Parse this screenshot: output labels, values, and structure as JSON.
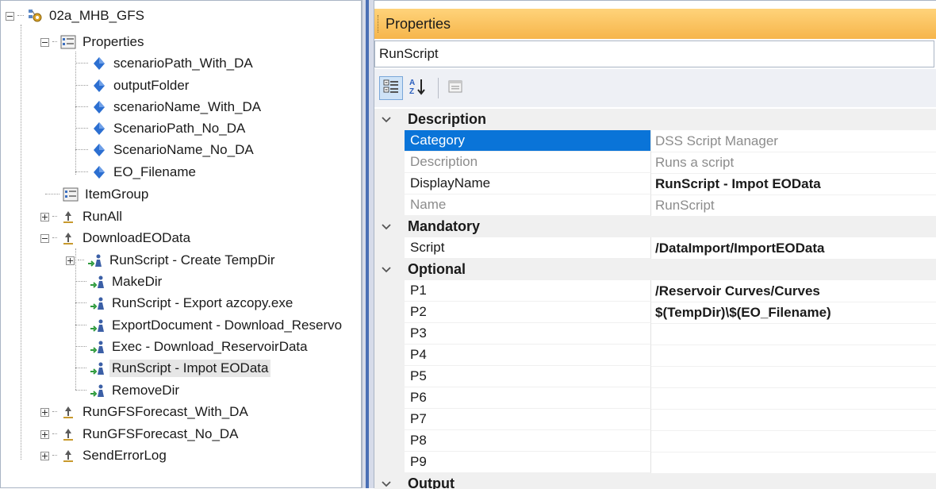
{
  "tree": {
    "root": {
      "label": "02a_MHB_GFS",
      "icon": "gear-network-icon"
    },
    "properties_node": {
      "label": "Properties",
      "icon": "property-grid-icon"
    },
    "property_items": [
      "scenarioPath_With_DA",
      "outputFolder",
      "scenarioName_With_DA",
      "ScenarioPath_No_DA",
      "ScenarioName_No_DA",
      "EO_Filename"
    ],
    "item_group": {
      "label": "ItemGroup",
      "icon": "property-grid-icon"
    },
    "run_all": {
      "label": "RunAll",
      "icon": "task-icon"
    },
    "download_eo": {
      "label": "DownloadEOData",
      "icon": "task-icon"
    },
    "download_children": [
      {
        "label": "RunScript - Create TempDir",
        "expandable": true
      },
      {
        "label": "MakeDir",
        "expandable": false
      },
      {
        "label": "RunScript - Export azcopy.exe",
        "expandable": false
      },
      {
        "label": "ExportDocument - Download_Reservo",
        "expandable": false
      },
      {
        "label": "Exec - Download_ReservoirData",
        "expandable": false
      },
      {
        "label": "RunScript - Impot EOData",
        "expandable": false,
        "selected": true
      },
      {
        "label": "RemoveDir",
        "expandable": false
      }
    ],
    "bottom_items": [
      "RunGFSForecast_With_DA",
      "RunGFSForecast_No_DA",
      "SendErrorLog"
    ]
  },
  "properties": {
    "title": "Properties",
    "object_name": "RunScript",
    "toolbar": [
      "categorized-icon",
      "alphabetical-sort-icon",
      "property-pages-icon"
    ],
    "categories": [
      {
        "name": "Description",
        "rows": [
          {
            "name": "Category",
            "value": "DSS Script Manager",
            "readonly": true,
            "selected": true
          },
          {
            "name": "Description",
            "value": "Runs a script",
            "readonly": true
          },
          {
            "name": "DisplayName",
            "value": "RunScript - Impot EOData",
            "bold": true
          },
          {
            "name": "Name",
            "value": "RunScript",
            "readonly": true
          }
        ]
      },
      {
        "name": "Mandatory",
        "rows": [
          {
            "name": "Script",
            "value": "/DataImport/ImportEOData",
            "bold": true
          }
        ]
      },
      {
        "name": "Optional",
        "rows": [
          {
            "name": "P1",
            "value": "/Reservoir Curves/Curves",
            "bold": true
          },
          {
            "name": "P2",
            "value": "$(TempDir)\\$(EO_Filename)",
            "bold": true
          },
          {
            "name": "P3",
            "value": ""
          },
          {
            "name": "P4",
            "value": ""
          },
          {
            "name": "P5",
            "value": ""
          },
          {
            "name": "P6",
            "value": ""
          },
          {
            "name": "P7",
            "value": ""
          },
          {
            "name": "P8",
            "value": ""
          },
          {
            "name": "P9",
            "value": ""
          }
        ]
      },
      {
        "name": "Output",
        "rows": []
      }
    ]
  },
  "colors": {
    "header_orange": "#f6b54b",
    "selection_blue": "#0a74d8",
    "splitter_blue": "#4a6fb5",
    "diamond_blue": "#2c6fd1"
  }
}
